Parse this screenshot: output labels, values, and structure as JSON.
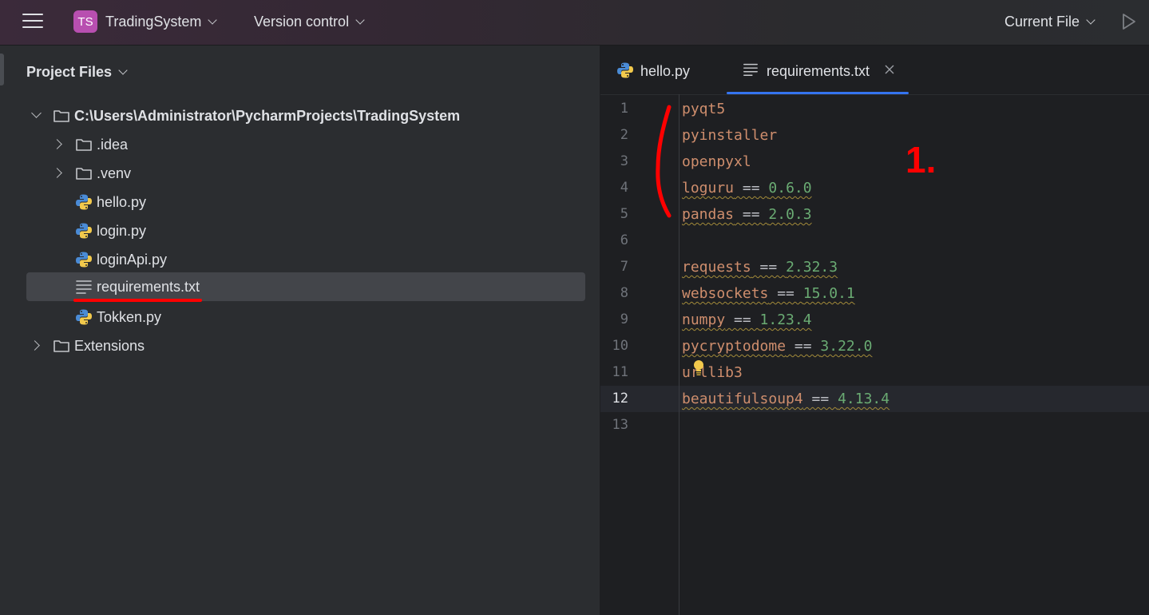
{
  "header": {
    "project_badge": "TS",
    "project_name": "TradingSystem",
    "version_control": "Version control",
    "run_config": "Current File"
  },
  "project_pane": {
    "title": "Project Files",
    "items": [
      {
        "label": "C:\\Users\\Administrator\\PycharmProjects\\TradingSystem",
        "kind": "folder",
        "expanded": true
      },
      {
        "label": ".idea",
        "kind": "folder",
        "expanded": false
      },
      {
        "label": ".venv",
        "kind": "folder",
        "expanded": false
      },
      {
        "label": "hello.py",
        "kind": "python"
      },
      {
        "label": "login.py",
        "kind": "python"
      },
      {
        "label": "loginApi.py",
        "kind": "python"
      },
      {
        "label": "requirements.txt",
        "kind": "text",
        "selected": true
      },
      {
        "label": "Tokken.py",
        "kind": "python"
      },
      {
        "label": "Extensions",
        "kind": "folder",
        "expanded": false
      }
    ]
  },
  "editor": {
    "tabs": [
      {
        "label": "hello.py",
        "active": false
      },
      {
        "label": "requirements.txt",
        "active": true
      }
    ],
    "current_line": 12,
    "lines": [
      {
        "num": "1",
        "pkg": "pyqt5",
        "op": "",
        "ver": ""
      },
      {
        "num": "2",
        "pkg": "pyinstaller",
        "op": "",
        "ver": ""
      },
      {
        "num": "3",
        "pkg": "openpyxl",
        "op": "",
        "ver": ""
      },
      {
        "num": "4",
        "pkg": "loguru",
        "op": " == ",
        "ver": "0.6.0"
      },
      {
        "num": "5",
        "pkg": "pandas",
        "op": " == ",
        "ver": "2.0.3"
      },
      {
        "num": "6",
        "pkg": "",
        "op": "",
        "ver": ""
      },
      {
        "num": "7",
        "pkg": "requests",
        "op": " == ",
        "ver": "2.32.3"
      },
      {
        "num": "8",
        "pkg": "websockets",
        "op": " == ",
        "ver": "15.0.1"
      },
      {
        "num": "9",
        "pkg": "numpy",
        "op": " == ",
        "ver": "1.23.4"
      },
      {
        "num": "10",
        "pkg": "pycryptodome",
        "op": " == ",
        "ver": "3.22.0"
      },
      {
        "num": "11",
        "pkg": "urllib3",
        "op": "",
        "ver": ""
      },
      {
        "num": "12",
        "pkg": "beautifulsoup4",
        "op": " == ",
        "ver": "4.13.4"
      },
      {
        "num": "13",
        "pkg": "",
        "op": "",
        "ver": ""
      }
    ]
  },
  "annotation": {
    "label": "1.",
    "color": "#ff0000"
  },
  "colors": {
    "accent": "#3574f0",
    "package": "#cf8e6d",
    "version": "#6aab73",
    "annotation": "#ff0000",
    "project_badge": "#b84fb0"
  }
}
